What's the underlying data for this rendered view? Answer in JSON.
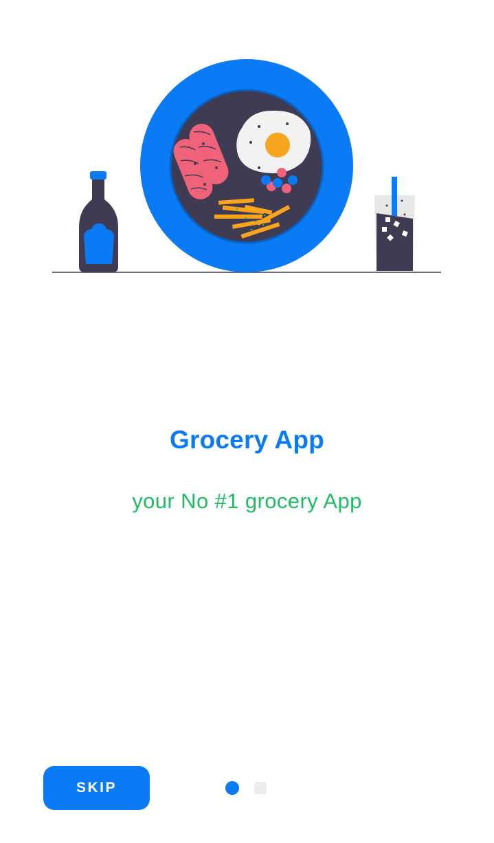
{
  "onboarding": {
    "title": "Grocery App",
    "subtitle": "your No #1 grocery App",
    "skip_label": "SKIP",
    "current_page": 1,
    "total_pages": 2
  },
  "illustration": {
    "subject": "breakfast-plate-with-bottle-and-drink",
    "icons": [
      "plate-icon",
      "sausage-icon",
      "fried-egg-icon",
      "berries-icon",
      "fries-icon",
      "sauce-bottle-icon",
      "drink-glass-icon"
    ]
  },
  "colors": {
    "primary": "#0A7BF5",
    "accent_green": "#1DBE63",
    "dark": "#3E3B52",
    "sausage": "#F0627A",
    "egg_yolk": "#F7A51E",
    "fries": "#F9A41A",
    "dot_inactive": "#ECECEC",
    "background": "#FFFFFF"
  }
}
